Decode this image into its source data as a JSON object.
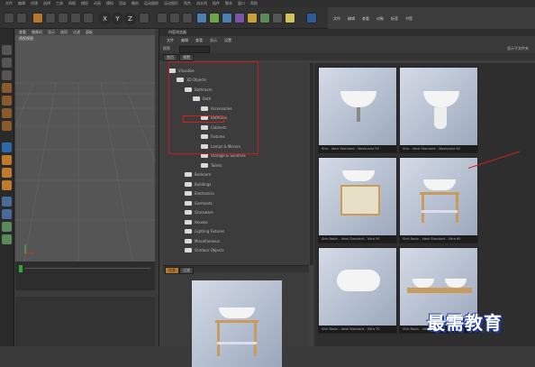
{
  "app": {
    "menus": [
      "文件",
      "编辑",
      "创建",
      "选择",
      "工具",
      "网格",
      "捕捉",
      "动画",
      "模拟",
      "渲染",
      "雕刻",
      "运动跟踪",
      "运动图形",
      "角色",
      "流水线",
      "插件",
      "脚本",
      "窗口",
      "帮助"
    ],
    "right_menu": [
      "文件",
      "编辑",
      "查看",
      "对象",
      "标签",
      "书签"
    ]
  },
  "viewport": {
    "menu": [
      "查看",
      "摄像机",
      "显示",
      "选项",
      "过滤",
      "面板"
    ],
    "label": "透视视图"
  },
  "browser": {
    "title": "内容浏览器",
    "menu": [
      "文件",
      "编辑",
      "查看",
      "显示",
      "设置"
    ],
    "search_label": "搜索",
    "search_placeholder": "",
    "options_label": "显示子文件夹",
    "tabs": [
      "首页",
      "预置"
    ],
    "tree": [
      {
        "label": "Visualize",
        "level": 0
      },
      {
        "label": "3D Objects",
        "level": 1
      },
      {
        "label": "Bathroom",
        "level": 2
      },
      {
        "label": "Bath",
        "level": 3
      },
      {
        "label": "Accessories",
        "level": 4
      },
      {
        "label": "Bathtubs",
        "level": 4
      },
      {
        "label": "Cabinets",
        "level": 4
      },
      {
        "label": "Fixtures",
        "level": 4
      },
      {
        "label": "Lamps & Mirrors",
        "level": 4
      },
      {
        "label": "Storage & Sundries",
        "level": 4
      },
      {
        "label": "Toilets",
        "level": 4
      },
      {
        "label": "Bedroom",
        "level": 2
      },
      {
        "label": "Buildings",
        "level": 2
      },
      {
        "label": "Electronics",
        "level": 2
      },
      {
        "label": "Garments",
        "level": 2
      },
      {
        "label": "Glassware",
        "level": 2
      },
      {
        "label": "Houses",
        "level": 2
      },
      {
        "label": "Lighting Fixtures",
        "level": 2
      },
      {
        "label": "Miscellaneous",
        "level": 2
      },
      {
        "label": "Outdoor Objects",
        "level": 2
      }
    ],
    "preview_tabs": [
      "信息",
      "过滤"
    ],
    "thumbnails": [
      {
        "caption": "Sink - Ideal Standard - Washpoint 50"
      },
      {
        "caption": "Sink - Ideal Standard - Washpoint 60"
      },
      {
        "caption": "Sink Basin - Ideal Standard - Vitra 50"
      },
      {
        "caption": "Sink Basin - Ideal Standard - Vitra 60"
      },
      {
        "caption": "Sink Basin - Ideal Standard - Vitra 70"
      },
      {
        "caption": "Sink Basin - Ideal Standard - Vitra 80"
      }
    ]
  },
  "watermark": "最需教育",
  "colors": {
    "accent": "#b8782a",
    "highlight": "#c02020"
  }
}
